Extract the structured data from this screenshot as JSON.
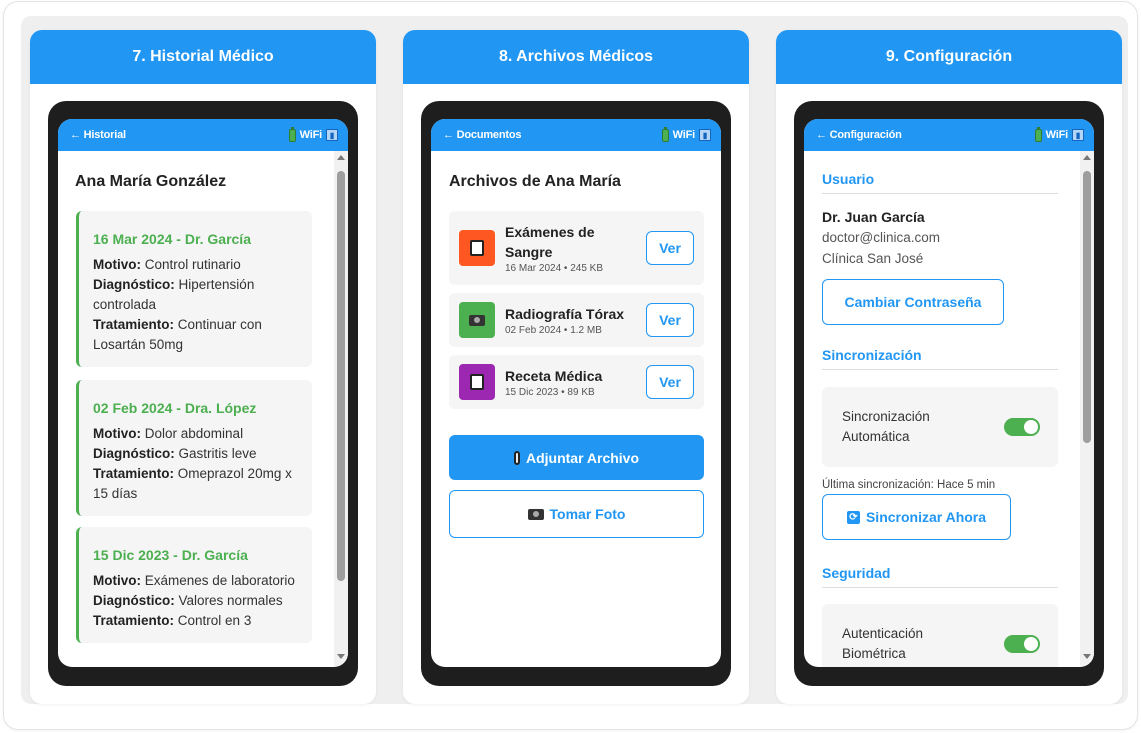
{
  "cards": [
    {
      "title": "7. Historial Médico",
      "status": {
        "back": "← Historial",
        "wifi": "WiFi"
      },
      "patient_name": "Ana María González",
      "visits": [
        {
          "date_doctor": "16 Mar 2024 - Dr. García",
          "motivo_label": "Motivo:",
          "motivo": "Control rutinario",
          "diag_label": "Diagnóstico:",
          "diagnostico": "Hipertensión controlada",
          "trat_label": "Tratamiento:",
          "tratamiento": "Continuar con Losartán 50mg"
        },
        {
          "date_doctor": "02 Feb 2024 - Dra. López",
          "motivo_label": "Motivo:",
          "motivo": "Dolor abdominal",
          "diag_label": "Diagnóstico:",
          "diagnostico": "Gastritis leve",
          "trat_label": "Tratamiento:",
          "tratamiento": "Omeprazol 20mg x 15 días"
        },
        {
          "date_doctor": "15 Dic 2023 - Dr. García",
          "motivo_label": "Motivo:",
          "motivo": "Exámenes de laboratorio",
          "diag_label": "Diagnóstico:",
          "diagnostico": "Valores normales",
          "trat_label": "Tratamiento:",
          "tratamiento": "Control en 3"
        }
      ]
    },
    {
      "title": "8. Archivos Médicos",
      "status": {
        "back": "← Documentos",
        "wifi": "WiFi"
      },
      "files_title": "Archivos de Ana María",
      "files": [
        {
          "name": "Exámenes de Sangre",
          "meta": "16 Mar 2024 • 245 KB",
          "button": "Ver",
          "color": "#ff5722"
        },
        {
          "name": "Radiografía Tórax",
          "meta": "02 Feb 2024 • 1.2 MB",
          "button": "Ver",
          "color": "#4caf50"
        },
        {
          "name": "Receta Médica",
          "meta": "15 Dic 2023 • 89 KB",
          "button": "Ver",
          "color": "#9c27b0"
        }
      ],
      "attach_button": "Adjuntar Archivo",
      "photo_button": "Tomar Foto"
    },
    {
      "title": "9. Configuración",
      "status": {
        "back": "← Configuración",
        "wifi": "WiFi"
      },
      "user_section": "Usuario",
      "user_name": "Dr. Juan García",
      "user_email": "doctor@clinica.com",
      "user_clinic": "Clínica San José",
      "change_password": "Cambiar Contraseña",
      "sync_section": "Sincronización",
      "auto_sync": "Sincronización Automática",
      "last_sync": "Última sincronización: Hace 5 min",
      "sync_now": "Sincronizar Ahora",
      "security_section": "Seguridad",
      "biometric": "Autenticación Biométrica"
    }
  ],
  "colors": {
    "primary": "#2196f3",
    "success": "#4caf50"
  }
}
